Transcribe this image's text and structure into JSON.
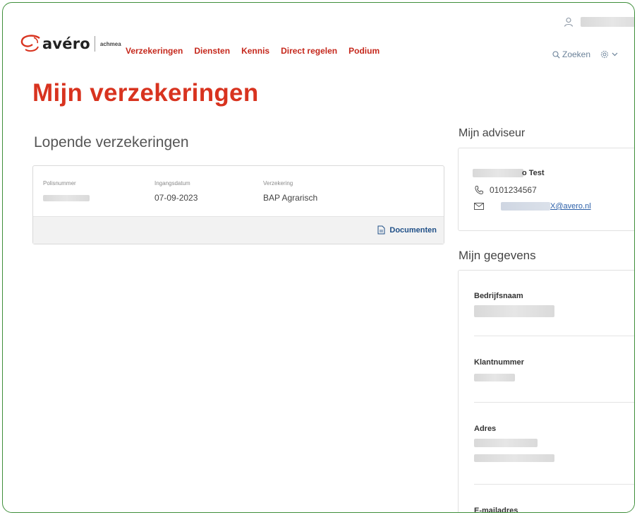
{
  "header": {
    "logo": {
      "brand": "avéro",
      "sub": "achmea"
    },
    "nav": [
      "Verzekeringen",
      "Diensten",
      "Kennis",
      "Direct regelen",
      "Podium"
    ],
    "search_label": "Zoeken",
    "icons": {
      "user": "user-icon",
      "search": "search-icon",
      "settings": "gear-icon",
      "chevron": "chevron-down-icon"
    }
  },
  "page_title": "Mijn verzekeringen",
  "section_title": "Lopende verzekeringen",
  "policy": {
    "columns": [
      "Polisnummer",
      "Ingangsdatum",
      "Verzekering"
    ],
    "startdate": "07-09-2023",
    "insurance": "BAP Agrarisch",
    "documents_label": "Documenten"
  },
  "advisor": {
    "title": "Mijn adviseur",
    "name_suffix": "o Test",
    "phone": "0101234567",
    "email_suffix": "X@avero.nl"
  },
  "details": {
    "title": "Mijn gegevens",
    "fields": [
      "Bedrijfsnaam",
      "Klantnummer",
      "Adres",
      "E-mailadres"
    ]
  },
  "colors": {
    "brand_red": "#d8331f",
    "nav_red": "#c5281c",
    "link_blue": "#2b5fa8",
    "frame_green": "#3f8f3b"
  }
}
